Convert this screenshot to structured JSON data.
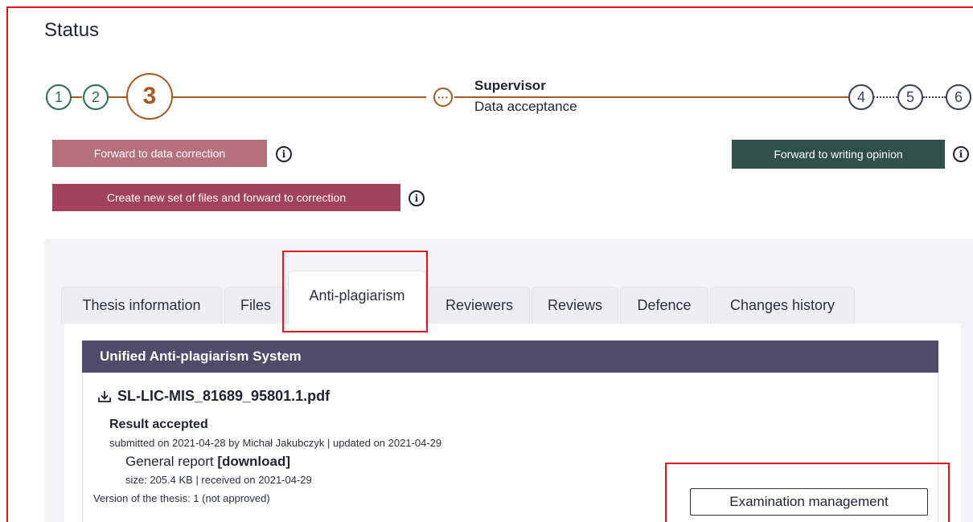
{
  "status": {
    "title": "Status"
  },
  "stepper": {
    "steps_done": [
      "1",
      "2"
    ],
    "step_current": "3",
    "step_mid": "···",
    "supervisor_title": "Supervisor",
    "supervisor_sub": "Data acceptance",
    "steps_pending": [
      "4",
      "5",
      "6"
    ]
  },
  "actions": {
    "forward_data_correction": "Forward to data correction",
    "create_new_set": "Create new set of files and forward to correction",
    "forward_writing_opinion": "Forward to writing opinion",
    "info_glyph": "i"
  },
  "tabs": [
    {
      "label": "Thesis information"
    },
    {
      "label": "Files"
    },
    {
      "label": "Anti-plagiarism"
    },
    {
      "label": "Reviewers"
    },
    {
      "label": "Reviews"
    },
    {
      "label": "Defence"
    },
    {
      "label": "Changes history"
    }
  ],
  "antiplagiarism": {
    "section_title": "Unified Anti-plagiarism System",
    "file_name": "SL-LIC-MIS_81689_95801.1.pdf",
    "result": "Result accepted",
    "submitted": "submitted on 2021-04-28 by Michał Jakubczyk | updated on 2021-04-29",
    "report_label": "General report",
    "report_link": "[download]",
    "report_meta": "size: 205.4 KB | received on 2021-04-29",
    "version": "Version of the thesis: 1 (not approved)",
    "exam_button": "Examination management"
  },
  "colors": {
    "done": "#2f6b4e",
    "current": "#a9561f",
    "pending": "#3a3f5c",
    "btn_light_red": "#b5707c",
    "btn_red": "#a3435b",
    "btn_green": "#2f4f4a",
    "section_header": "#4f4b68",
    "highlight": "#e8121c"
  }
}
